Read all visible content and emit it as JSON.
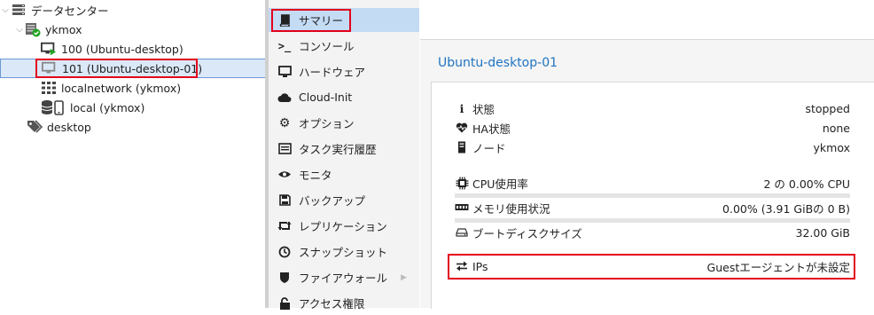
{
  "tree": {
    "datacenter": "データセンター",
    "node": "ykmox",
    "vm100": "100 (Ubuntu-desktop)",
    "vm101": "101 (Ubuntu-desktop-01)",
    "network": "localnetwork (ykmox)",
    "storage": "local (ykmox)",
    "tag": "desktop"
  },
  "nav": [
    {
      "label": "サマリー",
      "icon": "book-icon"
    },
    {
      "label": "コンソール",
      "icon": "terminal-icon"
    },
    {
      "label": "ハードウェア",
      "icon": "monitor-icon"
    },
    {
      "label": "Cloud-Init",
      "icon": "cloud-icon"
    },
    {
      "label": "オプション",
      "icon": "gear-icon"
    },
    {
      "label": "タスク実行履歴",
      "icon": "list-icon"
    },
    {
      "label": "モニタ",
      "icon": "eye-icon"
    },
    {
      "label": "バックアップ",
      "icon": "floppy-icon"
    },
    {
      "label": "レプリケーション",
      "icon": "retweet-icon"
    },
    {
      "label": "スナップショット",
      "icon": "history-icon"
    },
    {
      "label": "ファイアウォール",
      "icon": "shield-icon"
    },
    {
      "label": "アクセス権限",
      "icon": "unlock-icon"
    }
  ],
  "panel": {
    "title": "Ubuntu-desktop-01",
    "status_label": "状態",
    "status_value": "stopped",
    "ha_label": "HA状態",
    "ha_value": "none",
    "node_label": "ノード",
    "node_value": "ykmox",
    "cpu_label": "CPU使用率",
    "cpu_value": "2 の 0.00% CPU",
    "mem_label": "メモリ使用状況",
    "mem_value": "0.00% (3.91 GiBの 0 B)",
    "disk_label": "ブートディスクサイズ",
    "disk_value": "32.00 GiB",
    "ips_label": "IPs",
    "ips_value": "Guestエージェントが未設定"
  }
}
